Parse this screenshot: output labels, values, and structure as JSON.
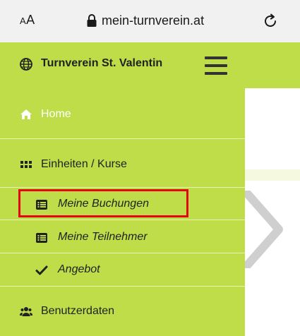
{
  "browser": {
    "text_size_label_small": "A",
    "text_size_label_large": "A",
    "url": "mein-turnverein.at",
    "icons": {
      "lock": "lock-icon",
      "reload": "reload-icon"
    }
  },
  "header": {
    "club_name": "Turnverein St. Valentin",
    "icons": {
      "globe": "globe-icon",
      "menu": "hamburger-icon"
    }
  },
  "menu": {
    "items": [
      {
        "label": "Home",
        "icon": "home-icon"
      },
      {
        "label": "Einheiten / Kurse",
        "icon": "grid-icon"
      },
      {
        "label": "Meine Buchungen",
        "icon": "list-icon",
        "highlighted": true
      },
      {
        "label": "Meine Teilnehmer",
        "icon": "list-icon"
      },
      {
        "label": "Angebot",
        "icon": "check-icon"
      },
      {
        "label": "Benutzerdaten",
        "icon": "users-icon"
      }
    ]
  },
  "colors": {
    "menu_green": "#bedd48",
    "highlight_red": "#e30613",
    "browser_bar": "#f1f1f2"
  }
}
